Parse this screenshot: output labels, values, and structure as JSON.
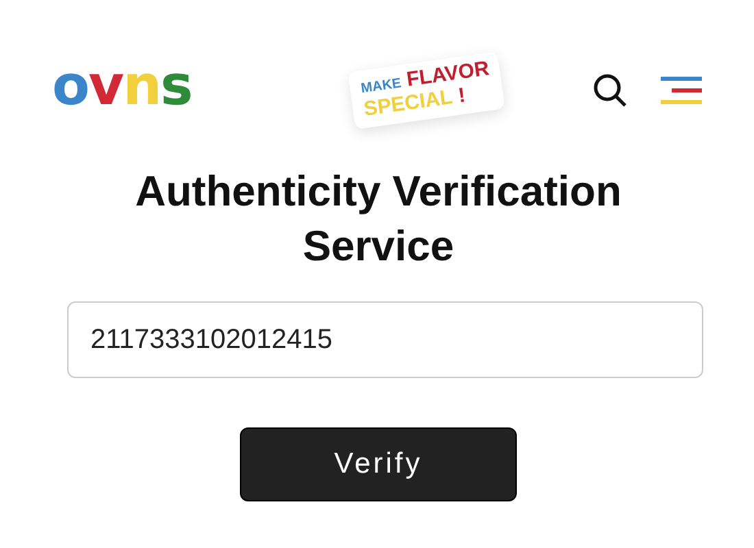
{
  "header": {
    "logo_letters": [
      {
        "text": "o",
        "color": "#3a86c8"
      },
      {
        "text": "v",
        "color": "#d12a36"
      },
      {
        "text": "n",
        "color": "#f2cf3c"
      },
      {
        "text": "s",
        "color": "#2e8b3a"
      }
    ],
    "tagline": {
      "line_1_small": "MAKE",
      "line_1_large": "FLAVOR",
      "line_2": "SPECIAL",
      "mark": "!"
    }
  },
  "title": "Authenticity Verification Service",
  "code_field": {
    "value": "2117333102012415"
  },
  "verify_button": {
    "label": "Verify"
  }
}
